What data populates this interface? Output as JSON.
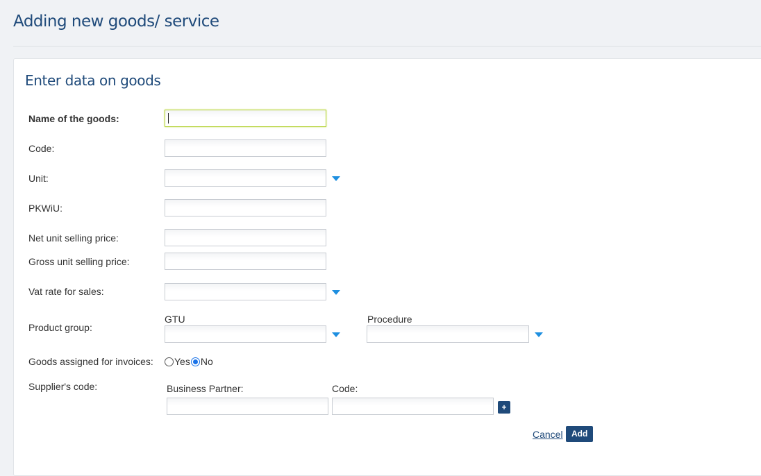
{
  "header": {
    "title": "Adding new goods/ service"
  },
  "panel": {
    "title": "Enter data on goods"
  },
  "form": {
    "name": {
      "label": "Name of the goods:",
      "value": ""
    },
    "code": {
      "label": "Code:",
      "value": ""
    },
    "unit": {
      "label": "Unit:",
      "value": ""
    },
    "pkwiu": {
      "label": "PKWiU:",
      "value": ""
    },
    "net_price": {
      "label": "Net unit selling price:",
      "value": ""
    },
    "gross_price": {
      "label": "Gross unit selling price:",
      "value": ""
    },
    "vat_rate": {
      "label": "Vat rate for sales:",
      "value": ""
    },
    "product_group": {
      "label": "Product group:",
      "gtu_label": "GTU",
      "gtu_value": "",
      "procedure_label": "Procedure",
      "procedure_value": ""
    },
    "invoices": {
      "label": "Goods assigned for invoices:",
      "yes_label": "Yes",
      "no_label": "No",
      "selected": "No"
    },
    "supplier": {
      "label": "Supplier's code:",
      "partner_label": "Business Partner:",
      "partner_value": "",
      "code_label": "Code:",
      "code_value": "",
      "add_symbol": "+"
    }
  },
  "actions": {
    "cancel_label": "Cancel",
    "add_label": "Add"
  },
  "colors": {
    "brand": "#1f4a7a",
    "accent": "#1e8fe0",
    "focus": "#b6d33c"
  },
  "icons": {
    "dropdown": "chevron-down-icon",
    "add": "plus-icon"
  }
}
